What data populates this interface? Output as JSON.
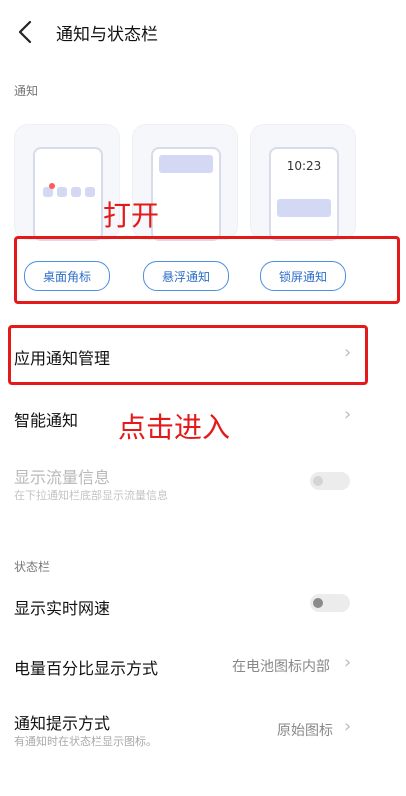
{
  "header": {
    "title": "通知与状态栏"
  },
  "notification_section": {
    "label": "通知",
    "cards": [
      {
        "type": "desktop-badge",
        "button_label": "桌面角标"
      },
      {
        "type": "floating",
        "button_label": "悬浮通知"
      },
      {
        "type": "lockscreen",
        "button_label": "锁屏通知",
        "time": "10:23"
      }
    ]
  },
  "annotations": {
    "open_text": "打开",
    "enter_text": "点击进入",
    "color": "#e41a1a"
  },
  "rows": {
    "app_notifications": {
      "title": "应用通知管理"
    },
    "smart_notifications": {
      "title": "智能通知"
    },
    "show_traffic": {
      "title": "显示流量信息",
      "subtitle": "在下拉通知栏底部显示流量信息",
      "enabled": false,
      "on": false
    }
  },
  "status_bar_section": {
    "label": "状态栏",
    "rows": {
      "realtime_speed": {
        "title": "显示实时网速",
        "on": false
      },
      "battery_percent": {
        "title": "电量百分比显示方式",
        "value": "在电池图标内部"
      },
      "notify_style": {
        "title": "通知提示方式",
        "subtitle": "有通知时在状态栏显示图标。",
        "value": "原始图标"
      }
    }
  },
  "colors": {
    "accent": "#4a8fe0",
    "badge_dot": "#ff5a5a",
    "placeholder": "#d3d9f5"
  }
}
